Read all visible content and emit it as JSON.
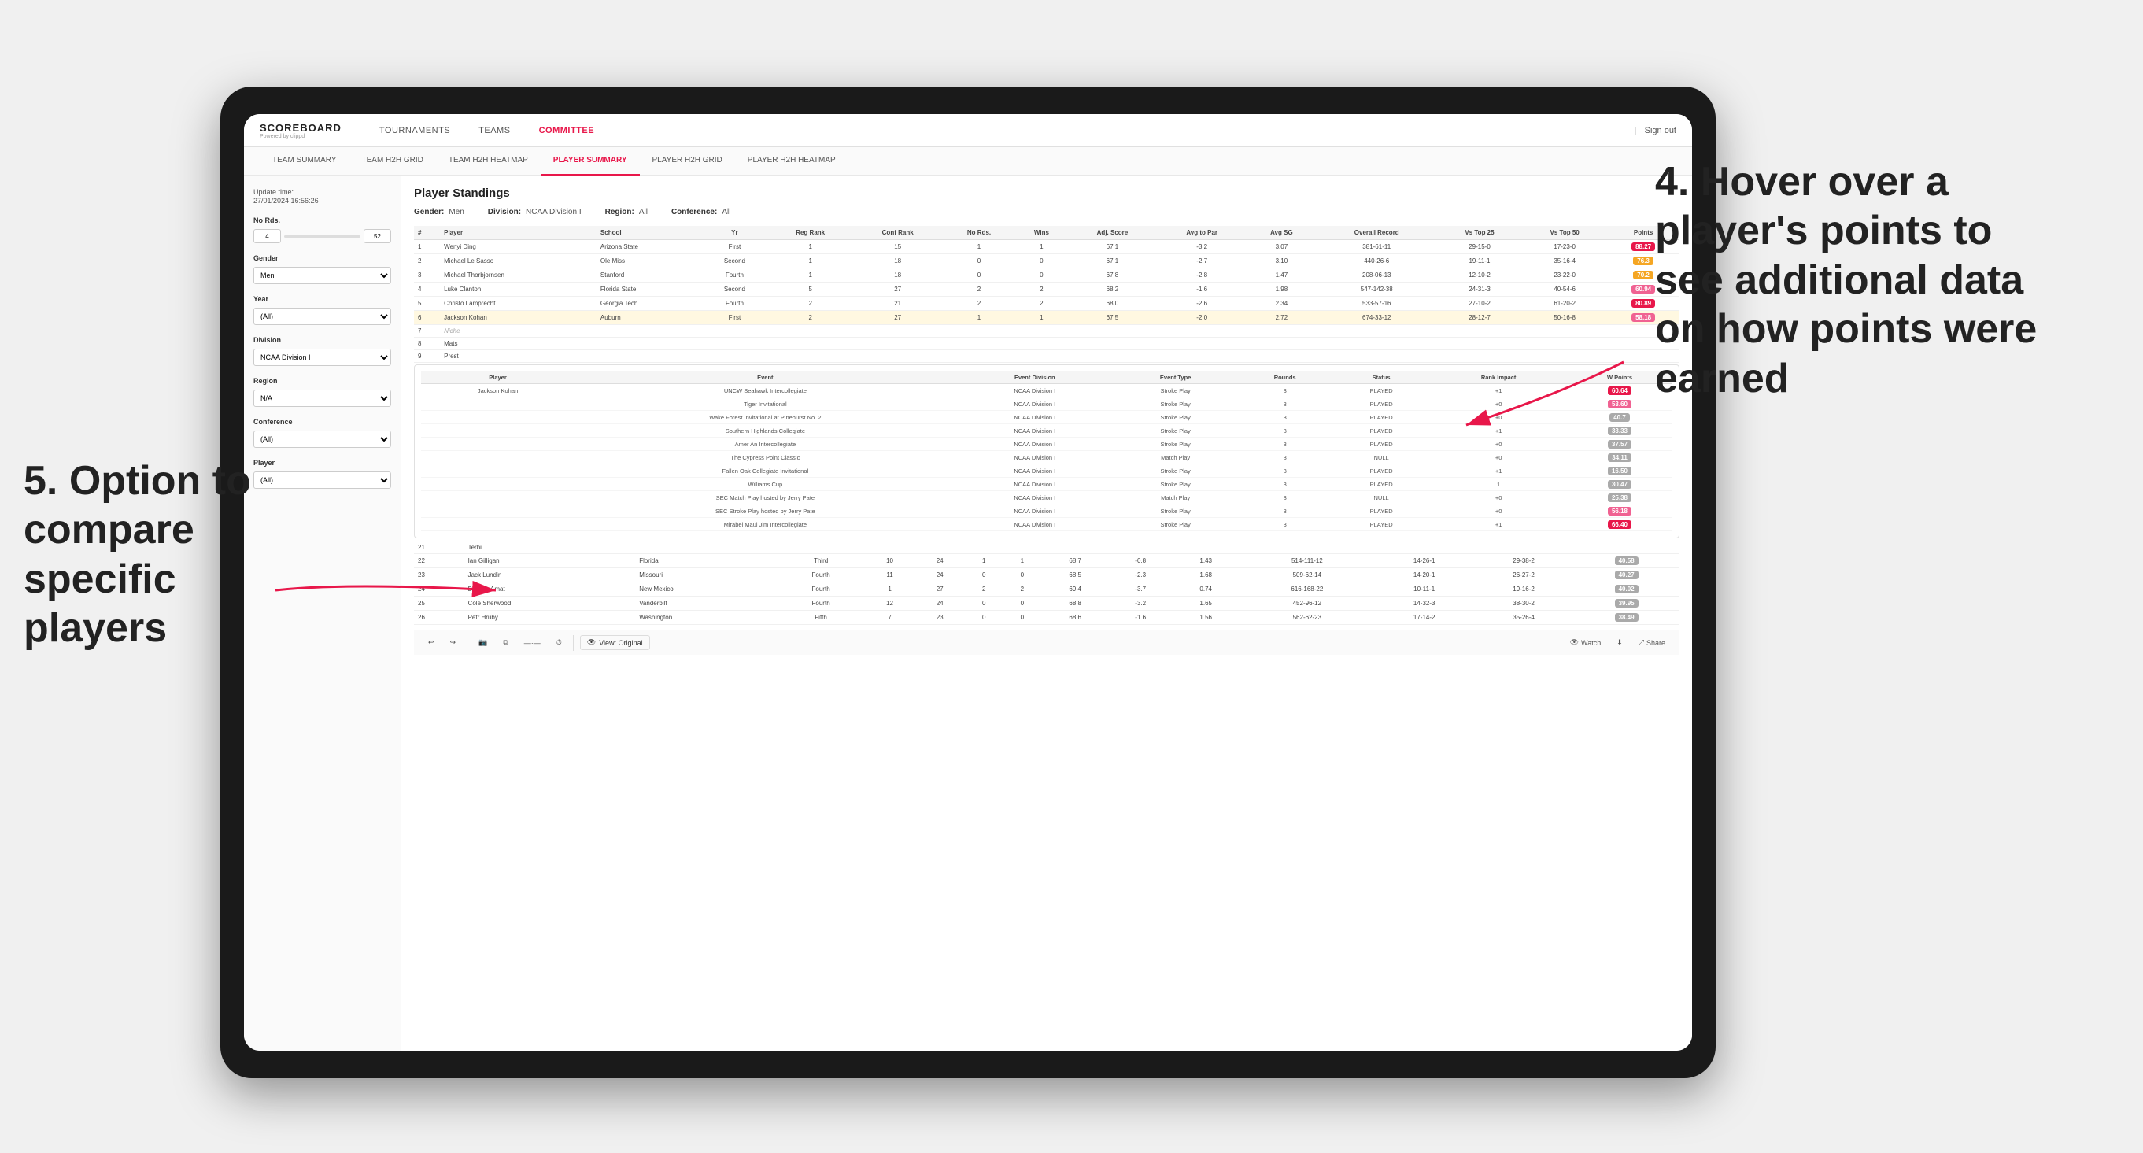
{
  "annotations": {
    "annotation4_title": "4. Hover over a player's points to see additional data on how points were earned",
    "annotation5_title": "5. Option to compare specific players"
  },
  "nav": {
    "logo": "SCOREBOARD",
    "logo_sub": "Powered by clippd",
    "items": [
      "TOURNAMENTS",
      "TEAMS",
      "COMMITTEE"
    ],
    "active": "COMMITTEE",
    "sign_out": "Sign out"
  },
  "sub_nav": {
    "items": [
      "TEAM SUMMARY",
      "TEAM H2H GRID",
      "TEAM H2H HEATMAP",
      "PLAYER SUMMARY",
      "PLAYER H2H GRID",
      "PLAYER H2H HEATMAP"
    ],
    "active": "PLAYER SUMMARY"
  },
  "sidebar": {
    "update_time_label": "Update time:",
    "update_time_value": "27/01/2024 16:56:26",
    "no_rds_label": "No Rds.",
    "no_rds_min": "4",
    "no_rds_max": "52",
    "gender_label": "Gender",
    "gender_value": "Men",
    "year_label": "Year",
    "year_value": "(All)",
    "division_label": "Division",
    "division_value": "NCAA Division I",
    "region_label": "Region",
    "region_value": "N/A",
    "conference_label": "Conference",
    "conference_value": "(All)",
    "player_label": "Player",
    "player_value": "(All)"
  },
  "main": {
    "title": "Player Standings",
    "gender_label": "Gender:",
    "gender_value": "Men",
    "division_label": "Division:",
    "division_value": "NCAA Division I",
    "region_label": "Region:",
    "region_value": "All",
    "conference_label": "Conference:",
    "conference_value": "All"
  },
  "table_headers": [
    "#",
    "Player",
    "School",
    "Yr",
    "Reg Rank",
    "Conf Rank",
    "No Rds.",
    "Wins",
    "Adj. Score",
    "Avg to Par",
    "Avg SG",
    "Overall Record",
    "Vs Top 25",
    "Vs Top 50",
    "Points"
  ],
  "players": [
    {
      "rank": 1,
      "name": "Wenyi Ding",
      "school": "Arizona State",
      "yr": "First",
      "reg_rank": 1,
      "conf_rank": 15,
      "rds": 1,
      "wins": 1,
      "adj_score": 67.1,
      "to_par": -3.2,
      "avg_sg": 3.07,
      "record": "381-61-11",
      "vs_top25": "29-15-0",
      "vs_top50": "17-23-0",
      "points": "88.27",
      "badge": "red"
    },
    {
      "rank": 2,
      "name": "Michael Le Sasso",
      "school": "Ole Miss",
      "yr": "Second",
      "reg_rank": 1,
      "conf_rank": 18,
      "rds": 0,
      "wins": 0,
      "adj_score": 67.1,
      "to_par": -2.7,
      "avg_sg": 3.1,
      "record": "440-26-6",
      "vs_top25": "19-11-1",
      "vs_top50": "35-16-4",
      "points": "76.3",
      "badge": "orange"
    },
    {
      "rank": 3,
      "name": "Michael Thorbjornsen",
      "school": "Stanford",
      "yr": "Fourth",
      "reg_rank": 1,
      "conf_rank": 18,
      "rds": 0,
      "wins": 0,
      "adj_score": 67.8,
      "to_par": -2.8,
      "avg_sg": 1.47,
      "record": "208-06-13",
      "vs_top25": "12-10-2",
      "vs_top50": "23-22-0",
      "points": "70.2",
      "badge": "orange"
    },
    {
      "rank": 4,
      "name": "Luke Clanton",
      "school": "Florida State",
      "yr": "Second",
      "reg_rank": 5,
      "conf_rank": 27,
      "rds": 2,
      "wins": 2,
      "adj_score": 68.2,
      "to_par": -1.6,
      "avg_sg": 1.98,
      "record": "547-142-38",
      "vs_top25": "24-31-3",
      "vs_top50": "40-54-6",
      "points": "60.94",
      "badge": "pink"
    },
    {
      "rank": 5,
      "name": "Christo Lamprecht",
      "school": "Georgia Tech",
      "yr": "Fourth",
      "reg_rank": 2,
      "conf_rank": 21,
      "rds": 2,
      "wins": 2,
      "adj_score": 68.0,
      "to_par": -2.6,
      "avg_sg": 2.34,
      "record": "533-57-16",
      "vs_top25": "27-10-2",
      "vs_top50": "61-20-2",
      "points": "80.89",
      "badge": "red"
    },
    {
      "rank": 6,
      "name": "Jackson Kohan",
      "school": "Auburn",
      "yr": "First",
      "reg_rank": 2,
      "conf_rank": 27,
      "rds": 1,
      "wins": 1,
      "adj_score": 67.5,
      "to_par": -2.0,
      "avg_sg": 2.72,
      "record": "674-33-12",
      "vs_top25": "28-12-7",
      "vs_top50": "50-16-8",
      "points": "58.18",
      "badge": "pink"
    }
  ],
  "tooltip_player": "Jackson Kohan",
  "tooltip_headers": [
    "Player",
    "Event",
    "Event Division",
    "Event Type",
    "Rounds",
    "Status",
    "Rank Impact",
    "W Points"
  ],
  "tooltip_rows": [
    {
      "player": "Jackson Kohan",
      "event": "UNCW Seahawk Intercollegiate",
      "division": "NCAA Division I",
      "type": "Stroke Play",
      "rounds": 3,
      "status": "PLAYED",
      "rank_impact": "+1",
      "w_points": "60.64",
      "badge": "red"
    },
    {
      "player": "",
      "event": "Tiger Invitational",
      "division": "NCAA Division I",
      "type": "Stroke Play",
      "rounds": 3,
      "status": "PLAYED",
      "rank_impact": "+0",
      "w_points": "53.60",
      "badge": "pink"
    },
    {
      "player": "",
      "event": "Wake Forest Invitational at Pinehurst No. 2",
      "division": "NCAA Division I",
      "type": "Stroke Play",
      "rounds": 3,
      "status": "PLAYED",
      "rank_impact": "+0",
      "w_points": "40.7",
      "badge": "light"
    },
    {
      "player": "",
      "event": "Southern Highlands Collegiate",
      "division": "NCAA Division I",
      "type": "Stroke Play",
      "rounds": 3,
      "status": "PLAYED",
      "rank_impact": "+1",
      "w_points": "33.33",
      "badge": "light"
    },
    {
      "player": "",
      "event": "Amer An Intercollegiate",
      "division": "NCAA Division I",
      "type": "Stroke Play",
      "rounds": 3,
      "status": "PLAYED",
      "rank_impact": "+0",
      "w_points": "37.57",
      "badge": "light"
    },
    {
      "player": "",
      "event": "The Cypress Point Classic",
      "division": "NCAA Division I",
      "type": "Match Play",
      "rounds": 3,
      "status": "NULL",
      "rank_impact": "+0",
      "w_points": "34.11",
      "badge": "light"
    },
    {
      "player": "",
      "event": "Fallen Oak Collegiate Invitational",
      "division": "NCAA Division I",
      "type": "Stroke Play",
      "rounds": 3,
      "status": "PLAYED",
      "rank_impact": "+1",
      "w_points": "16.50",
      "badge": "light"
    },
    {
      "player": "",
      "event": "Williams Cup",
      "division": "NCAA Division I",
      "type": "Stroke Play",
      "rounds": 3,
      "status": "PLAYED",
      "rank_impact": "1",
      "w_points": "30.47",
      "badge": "light"
    },
    {
      "player": "",
      "event": "SEC Match Play hosted by Jerry Pate",
      "division": "NCAA Division I",
      "type": "Match Play",
      "rounds": 3,
      "status": "NULL",
      "rank_impact": "+0",
      "w_points": "25.38",
      "badge": "light"
    },
    {
      "player": "",
      "event": "SEC Stroke Play hosted by Jerry Pate",
      "division": "NCAA Division I",
      "type": "Stroke Play",
      "rounds": 3,
      "status": "PLAYED",
      "rank_impact": "+0",
      "w_points": "56.18",
      "badge": "pink"
    },
    {
      "player": "",
      "event": "Mirabel Maui Jim Intercollegiate",
      "division": "NCAA Division I",
      "type": "Stroke Play",
      "rounds": 3,
      "status": "PLAYED",
      "rank_impact": "+1",
      "w_points": "66.40",
      "badge": "red"
    }
  ],
  "extra_players": [
    {
      "rank": 22,
      "name": "Ian Gilligan",
      "school": "Florida",
      "yr": "Third",
      "reg_rank": 10,
      "conf_rank": 24,
      "rds": 1,
      "wins": 1,
      "adj_score": 68.7,
      "to_par": -0.8,
      "avg_sg": 1.43,
      "record": "514-111-12",
      "vs_top25": "14-26-1",
      "vs_top50": "29-38-2",
      "points": "40.58",
      "badge": "light"
    },
    {
      "rank": 23,
      "name": "Jack Lundin",
      "school": "Missouri",
      "yr": "Fourth",
      "reg_rank": 11,
      "conf_rank": 24,
      "rds": 0,
      "wins": 0,
      "adj_score": 68.5,
      "to_par": -2.3,
      "avg_sg": 1.68,
      "record": "509-62-14",
      "vs_top25": "14-20-1",
      "vs_top50": "26-27-2",
      "points": "40.27",
      "badge": "light"
    },
    {
      "rank": 24,
      "name": "Bastien Amat",
      "school": "New Mexico",
      "yr": "Fourth",
      "reg_rank": 1,
      "conf_rank": 27,
      "rds": 2,
      "wins": 2,
      "adj_score": 69.4,
      "to_par": -3.7,
      "avg_sg": 0.74,
      "record": "616-168-22",
      "vs_top25": "10-11-1",
      "vs_top50": "19-16-2",
      "points": "40.02",
      "badge": "light"
    },
    {
      "rank": 25,
      "name": "Cole Sherwood",
      "school": "Vanderbilt",
      "yr": "Fourth",
      "reg_rank": 12,
      "conf_rank": 24,
      "rds": 0,
      "wins": 0,
      "adj_score": 68.8,
      "to_par": -3.2,
      "avg_sg": 1.65,
      "record": "452-96-12",
      "vs_top25": "14-32-3",
      "vs_top50": "38-30-2",
      "points": "39.95",
      "badge": "light"
    },
    {
      "rank": 26,
      "name": "Petr Hruby",
      "school": "Washington",
      "yr": "Fifth",
      "reg_rank": 7,
      "conf_rank": 23,
      "rds": 0,
      "wins": 0,
      "adj_score": 68.6,
      "to_par": -1.6,
      "avg_sg": 1.56,
      "record": "562-62-23",
      "vs_top25": "17-14-2",
      "vs_top50": "35-26-4",
      "points": "38.49",
      "badge": "light"
    }
  ],
  "toolbar": {
    "undo": "↩",
    "redo": "↪",
    "camera": "📷",
    "copy": "📋",
    "dash": "—",
    "clock": "⏱",
    "view_label": "View: Original",
    "watch": "👁 Watch",
    "download": "⬇",
    "share": "Share"
  }
}
